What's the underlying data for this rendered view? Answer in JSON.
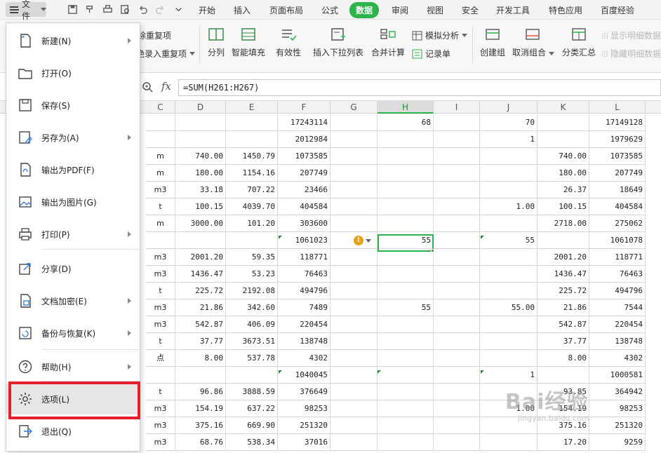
{
  "menubar": {
    "file_label": "文件",
    "tabs": [
      {
        "label": "开始"
      },
      {
        "label": "插入"
      },
      {
        "label": "页面布局"
      },
      {
        "label": "公式"
      },
      {
        "label": "数据",
        "active": true
      },
      {
        "label": "审阅"
      },
      {
        "label": "视图"
      },
      {
        "label": "安全"
      },
      {
        "label": "开发工具"
      },
      {
        "label": "特色应用"
      },
      {
        "label": "百度经验"
      }
    ]
  },
  "ribbon": {
    "dup_highlight": "除重复项",
    "dup_reject": "拒绝录入重复项",
    "split": "分列",
    "smart_fill": "智能填充",
    "validity": "有效性",
    "insert_dropdown": "插入下拉列表",
    "merge_calc": "合并计算",
    "simulate": "模拟分析",
    "record_form": "记录单",
    "create_group": "创建组",
    "ungroup": "取消组合",
    "subtotal": "分类汇总",
    "show_detail": "显示明细数据",
    "hide_detail": "隐藏明细数据"
  },
  "formula_bar": {
    "fx": "fx",
    "formula": "=SUM(H261:H267)"
  },
  "grid": {
    "columns": [
      "C",
      "D",
      "E",
      "F",
      "G",
      "H",
      "I",
      "J",
      "K",
      "L"
    ],
    "active_column": "H",
    "rows": [
      {
        "C": "",
        "D": "",
        "E": "",
        "F": "17243114",
        "G": "",
        "H": "68",
        "I": "",
        "J": "70",
        "K": "",
        "L": "17149128"
      },
      {
        "C": "",
        "D": "",
        "E": "",
        "F": "2012984",
        "G": "",
        "H": "",
        "I": "",
        "J": "1",
        "K": "",
        "L": "1979629"
      },
      {
        "C": "m",
        "D": "740.00",
        "E": "1450.79",
        "F": "1073585",
        "G": "",
        "H": "",
        "I": "",
        "J": "",
        "K": "740.00",
        "L": "1073585"
      },
      {
        "C": "m",
        "D": "180.00",
        "E": "1154.16",
        "F": "207749",
        "G": "",
        "H": "",
        "I": "",
        "J": "",
        "K": "180.00",
        "L": "207749"
      },
      {
        "C": "m3",
        "D": "33.18",
        "E": "707.22",
        "F": "23466",
        "G": "",
        "H": "",
        "I": "",
        "J": "",
        "K": "26.37",
        "L": "18649"
      },
      {
        "C": "t",
        "D": "100.15",
        "E": "4039.70",
        "F": "404584",
        "G": "",
        "H": "",
        "I": "",
        "J": "1.00",
        "K": "100.15",
        "L": "404584"
      },
      {
        "C": "m",
        "D": "3000.00",
        "E": "101.20",
        "F": "303600",
        "G": "",
        "H": "",
        "I": "",
        "J": "",
        "K": "2718.00",
        "L": "275062"
      },
      {
        "C": "",
        "D": "",
        "E": "",
        "F": "1061023",
        "G": "",
        "H": "55",
        "I": "",
        "J": "55",
        "K": "",
        "L": "1061078"
      },
      {
        "C": "m3",
        "D": "2001.20",
        "E": "59.35",
        "F": "118771",
        "G": "",
        "H": "",
        "I": "",
        "J": "",
        "K": "2001.20",
        "L": "118771"
      },
      {
        "C": "m3",
        "D": "1436.47",
        "E": "53.23",
        "F": "76463",
        "G": "",
        "H": "",
        "I": "",
        "J": "",
        "K": "1436.47",
        "L": "76463"
      },
      {
        "C": "t",
        "D": "225.72",
        "E": "2192.08",
        "F": "494796",
        "G": "",
        "H": "",
        "I": "",
        "J": "",
        "K": "225.72",
        "L": "494796"
      },
      {
        "C": "m3",
        "D": "21.86",
        "E": "342.60",
        "F": "7489",
        "G": "",
        "H": "55",
        "I": "",
        "J": "55.00",
        "K": "21.86",
        "L": "7544"
      },
      {
        "C": "m3",
        "D": "542.87",
        "E": "406.09",
        "F": "220454",
        "G": "",
        "H": "",
        "I": "",
        "J": "",
        "K": "542.87",
        "L": "220454"
      },
      {
        "C": "t",
        "D": "37.77",
        "E": "3673.51",
        "F": "138748",
        "G": "",
        "H": "",
        "I": "",
        "J": "",
        "K": "37.77",
        "L": "138748"
      },
      {
        "C": "点",
        "D": "8.00",
        "E": "537.78",
        "F": "4302",
        "G": "",
        "H": "",
        "I": "",
        "J": "",
        "K": "8.00",
        "L": "4302"
      },
      {
        "C": "",
        "D": "",
        "E": "",
        "F": "1040045",
        "G": "",
        "H": "",
        "I": "",
        "J": "1",
        "K": "",
        "L": "1000581"
      },
      {
        "C": "t",
        "D": "96.86",
        "E": "3888.59",
        "F": "376649",
        "G": "",
        "H": "",
        "I": "",
        "J": "",
        "K": "93.85",
        "L": "364942"
      },
      {
        "C": "m3",
        "D": "154.19",
        "E": "637.22",
        "F": "98253",
        "G": "",
        "H": "",
        "I": "",
        "J": "1.00",
        "K": "154.19",
        "L": "98253"
      },
      {
        "C": "m3",
        "D": "375.16",
        "E": "669.90",
        "F": "251320",
        "G": "",
        "H": "",
        "I": "",
        "J": "",
        "K": "375.16",
        "L": "251320"
      },
      {
        "C": "m3",
        "D": "68.76",
        "E": "538.34",
        "F": "37016",
        "G": "",
        "H": "",
        "I": "",
        "J": "",
        "K": "17.20",
        "L": "9259"
      }
    ]
  },
  "file_menu": {
    "items": [
      {
        "label": "新建(N)",
        "icon": "new-file-icon",
        "submenu": true
      },
      {
        "label": "打开(O)",
        "icon": "open-folder-icon",
        "submenu": false
      },
      {
        "label": "保存(S)",
        "icon": "save-icon",
        "submenu": false
      },
      {
        "label": "另存为(A)",
        "icon": "save-as-icon",
        "submenu": true
      },
      {
        "label": "输出为PDF(F)",
        "icon": "export-pdf-icon",
        "submenu": false
      },
      {
        "label": "输出为图片(G)",
        "icon": "export-image-icon",
        "submenu": false
      },
      {
        "label": "打印(P)",
        "icon": "print-icon",
        "submenu": true
      },
      {
        "label": "分享(D)",
        "icon": "share-icon",
        "submenu": false
      },
      {
        "label": "文档加密(E)",
        "icon": "encrypt-icon",
        "submenu": true
      },
      {
        "label": "备份与恢复(K)",
        "icon": "backup-icon",
        "submenu": true
      },
      {
        "label": "帮助(H)",
        "icon": "help-icon",
        "submenu": true
      },
      {
        "label": "选项(L)",
        "icon": "gear-icon",
        "submenu": false,
        "highlighted": true
      },
      {
        "label": "退出(Q)",
        "icon": "exit-icon",
        "submenu": false
      }
    ]
  },
  "watermark": {
    "brand": "Bai经验",
    "url": "jingyan.baidu.com"
  },
  "colors": {
    "accent_green": "#2cb34a",
    "highlight_red": "#e5202a"
  }
}
